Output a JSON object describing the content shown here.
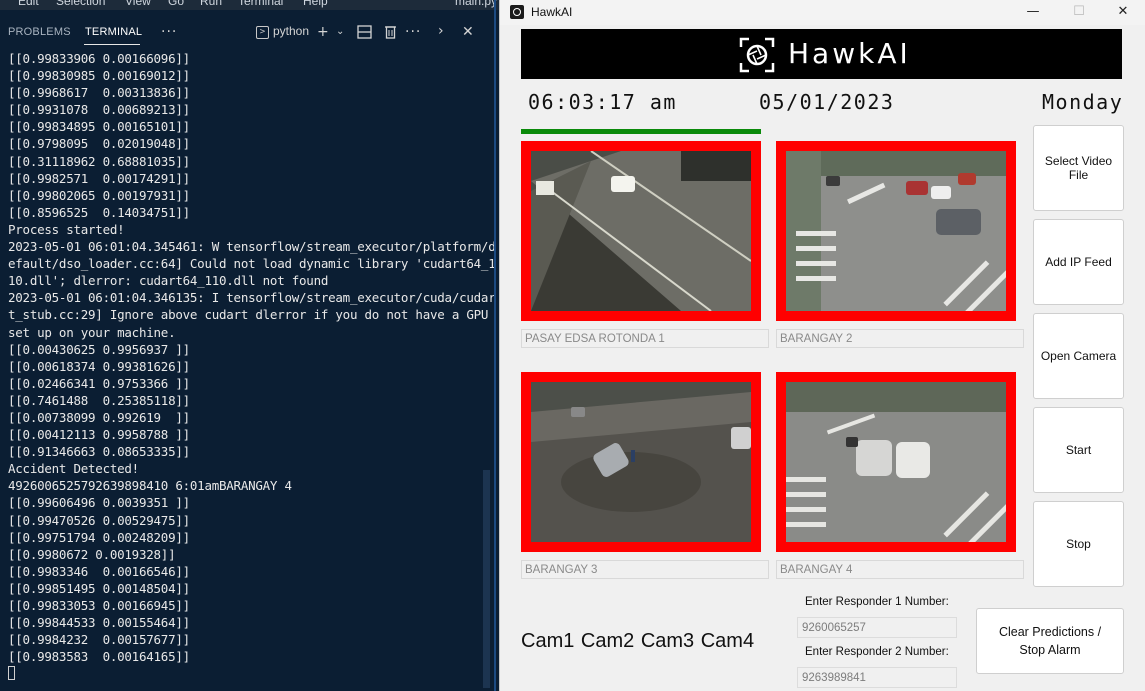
{
  "editor": {
    "menu": [
      "Edit",
      "Selection",
      "View",
      "Go",
      "Run",
      "Terminal",
      "Help"
    ],
    "file_title": "main.py",
    "panel_tabs": {
      "problems": "PROBLEMS",
      "terminal": "TERMINAL"
    },
    "shell_label": "python",
    "icons": [
      "terminal-shell-icon",
      "plus-icon",
      "chevron-down-icon",
      "split-icon",
      "trash-icon",
      "ellipsis-icon",
      "chevron-right-icon",
      "close-icon"
    ],
    "terminal_lines": [
      "[[0.99833906 0.00166096]]",
      "[[0.99830985 0.00169012]]",
      "[[0.9968617  0.00313836]]",
      "[[0.9931078  0.00689213]]",
      "[[0.99834895 0.00165101]]",
      "[[0.9798095  0.02019048]]",
      "[[0.31118962 0.68881035]]",
      "[[0.9982571  0.00174291]]",
      "[[0.99802065 0.00197931]]",
      "[[0.8596525  0.14034751]]",
      "Process started!",
      "2023-05-01 06:01:04.345461: W tensorflow/stream_executor/platform/d",
      "efault/dso_loader.cc:64] Could not load dynamic library 'cudart64_1",
      "10.dll'; dlerror: cudart64_110.dll not found",
      "2023-05-01 06:01:04.346135: I tensorflow/stream_executor/cuda/cudar",
      "t_stub.cc:29] Ignore above cudart dlerror if you do not have a GPU",
      "set up on your machine.",
      "[[0.00430625 0.9956937 ]]",
      "[[0.00618374 0.99381626]]",
      "[[0.02466341 0.9753366 ]]",
      "[[0.7461488  0.25385118]]",
      "[[0.00738099 0.992619  ]]",
      "[[0.00412113 0.9958788 ]]",
      "[[0.91346663 0.08653335]]",
      "Accident Detected!",
      "4926006525792639898410 6:01amBARANGAY 4",
      "[[0.99606496 0.0039351 ]]",
      "[[0.99470526 0.00529475]]",
      "[[0.99751794 0.00248209]]",
      "[[0.9980672 0.0019328]]",
      "[[0.9983346  0.00166546]]",
      "[[0.99851495 0.00148504]]",
      "[[0.99833053 0.00166945]]",
      "[[0.99844533 0.00155464]]",
      "[[0.9984232  0.00157677]]",
      "[[0.9983583  0.00164165]]"
    ]
  },
  "hawkai": {
    "window_title": "HawkAI",
    "window_controls": {
      "minimize": "—",
      "maximize": "☐",
      "close": "✕"
    },
    "banner_title": "HawkAI",
    "time": "06:03:17 am",
    "date": "05/01/2023",
    "day": "Monday",
    "cameras": [
      {
        "label": "PASAY EDSA ROTONDA 1",
        "alert_color": "#ff0000"
      },
      {
        "label": "BARANGAY 2",
        "alert_color": "#ff0000"
      },
      {
        "label": "BARANGAY 3",
        "alert_color": "#ff0000"
      },
      {
        "label": "BARANGAY 4",
        "alert_color": "#ff0000"
      }
    ],
    "buttons": {
      "select_video": "Select Video File",
      "add_ip": "Add IP Feed",
      "open_camera": "Open Camera",
      "start": "Start",
      "stop": "Stop",
      "clear": "Clear Predictions / Stop Alarm"
    },
    "cam_list": "Cam1 Cam2 Cam3 Cam4",
    "responder1": {
      "label": "Enter Responder 1 Number:",
      "value": "9260065257"
    },
    "responder2": {
      "label": "Enter Responder 2 Number:",
      "value": "9263989841"
    },
    "colors": {
      "alert": "#ff0000",
      "status_bar": "#0a8a0a",
      "banner": "#000000"
    }
  }
}
